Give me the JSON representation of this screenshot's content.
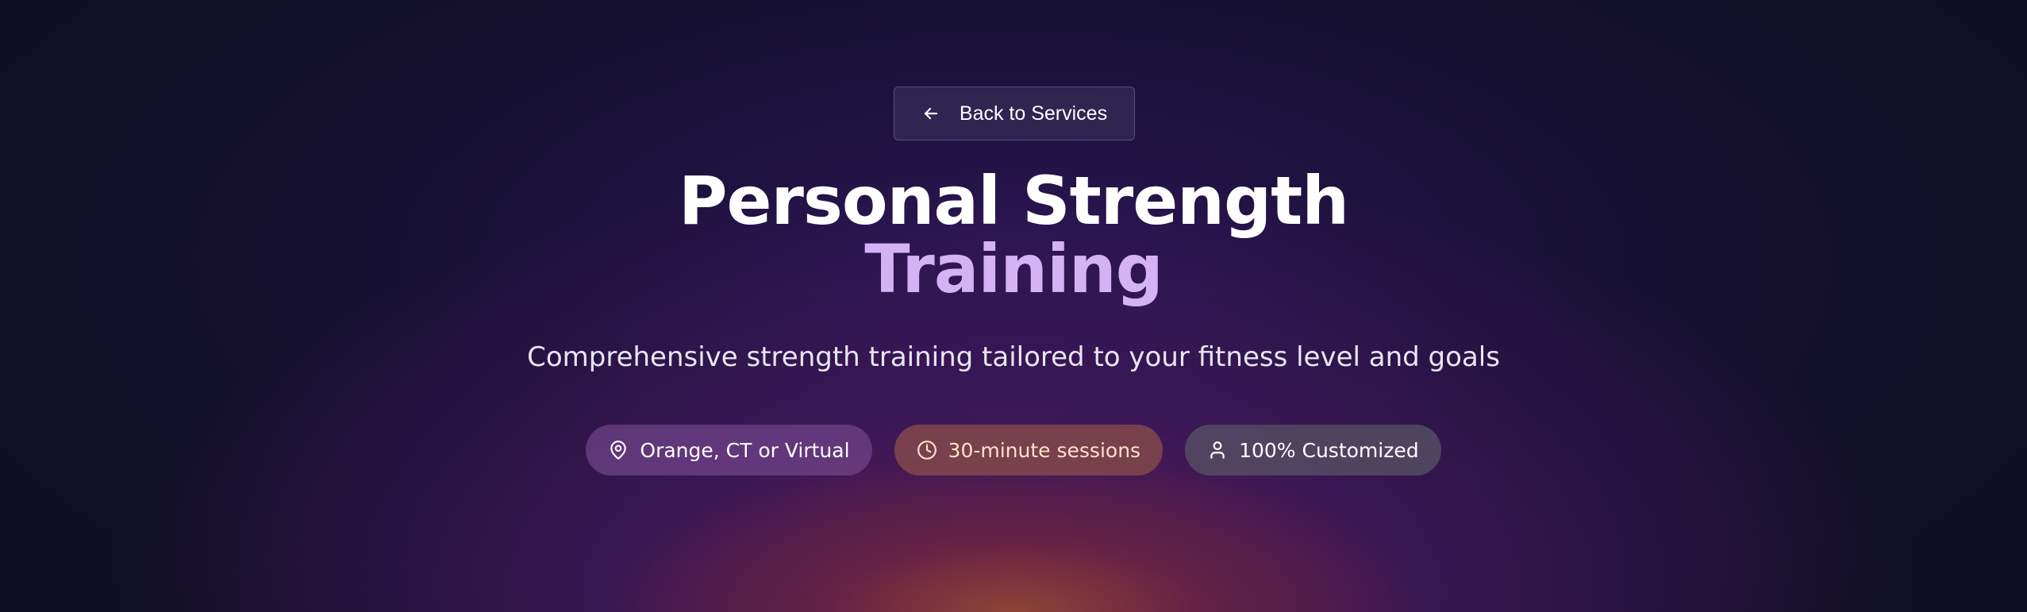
{
  "back_button": {
    "label": "Back to Services",
    "icon": "arrow-left-icon"
  },
  "hero": {
    "title_line1": "Personal Strength",
    "title_line2": "Training",
    "subtitle": "Comprehensive strength training tailored to your fitness level and goals"
  },
  "badges": [
    {
      "label": "Orange, CT or Virtual",
      "icon": "map-pin-icon"
    },
    {
      "label": "30-minute sessions",
      "icon": "clock-icon"
    },
    {
      "label": "100% Customized",
      "icon": "user-icon"
    }
  ],
  "colors": {
    "background": "#0e0f22",
    "accent": "#d3b3f5",
    "text": "#ffffff"
  }
}
